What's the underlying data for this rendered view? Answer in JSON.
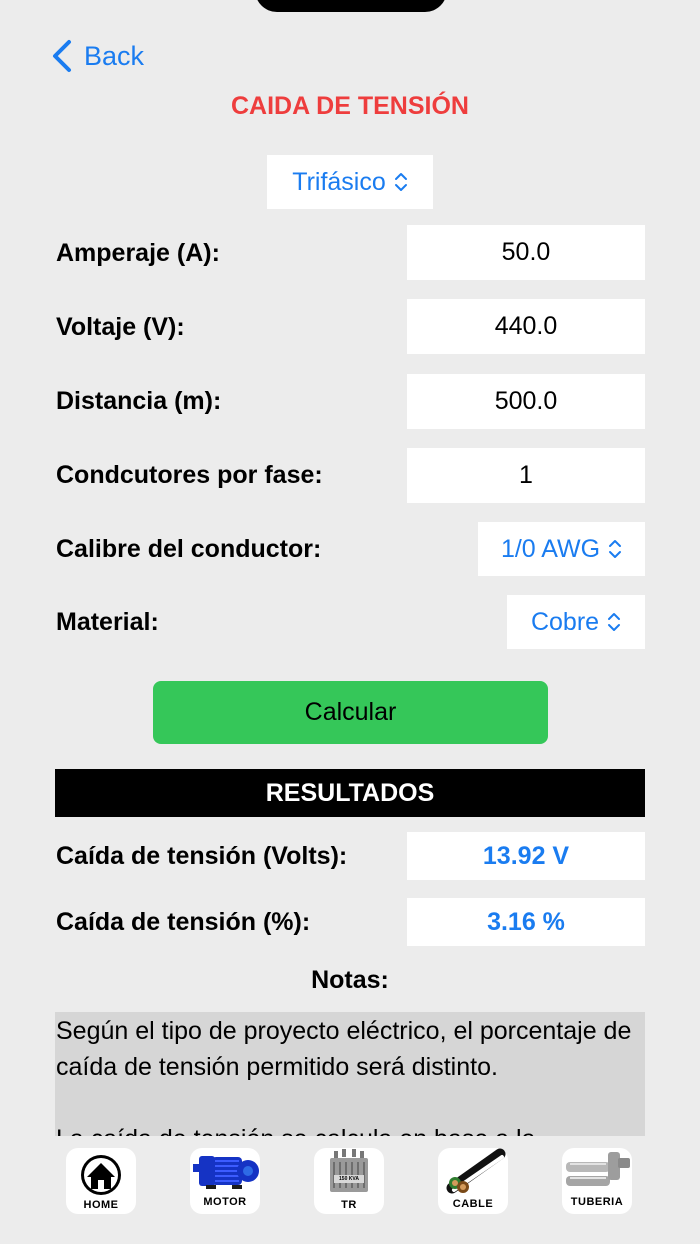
{
  "nav": {
    "back_label": "Back"
  },
  "title": "CAIDA DE TENSIÓN",
  "phase_picker": {
    "value": "Trifásico"
  },
  "inputs": [
    {
      "label": "Amperaje (A):",
      "value": "50.0"
    },
    {
      "label": "Voltaje (V):",
      "value": "440.0"
    },
    {
      "label": "Distancia (m):",
      "value": "500.0"
    },
    {
      "label": "Condcutores por fase:",
      "value": "1"
    }
  ],
  "gauge": {
    "label": "Calibre del conductor:",
    "value": "1/0 AWG"
  },
  "material": {
    "label": "Material:",
    "value": "Cobre"
  },
  "calculate_label": "Calcular",
  "results": {
    "header": "RESULTADOS",
    "volts_label": "Caída de tensión (Volts):",
    "volts_value": "13.92 V",
    "percent_label": "Caída de tensión (%):",
    "percent_value": "3.16 %"
  },
  "notes": {
    "title": "Notas:",
    "text": "Según el tipo de proyecto eléctrico, el porcentaje de caída de tensión permitido será distinto.\n\nLa caída de tensión se calcula en base a la"
  },
  "tabbar": [
    {
      "label": "HOME",
      "icon": "home-icon"
    },
    {
      "label": "MOTOR",
      "icon": "motor-icon"
    },
    {
      "label": "TR",
      "icon": "transformer-icon",
      "badge": "150 KVA"
    },
    {
      "label": "CABLE",
      "icon": "cable-icon"
    },
    {
      "label": "TUBERIA",
      "icon": "pipe-icon"
    }
  ],
  "colors": {
    "accent": "#1a7cf0",
    "title": "#ee3d3d",
    "button": "#35c759",
    "background": "#ececec"
  }
}
